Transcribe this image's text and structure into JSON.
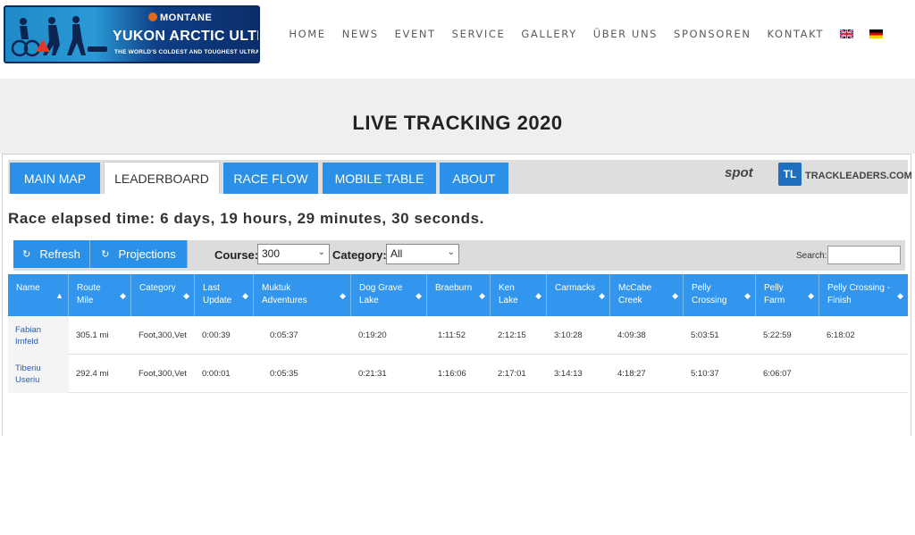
{
  "header": {
    "logo": {
      "brand": "MONTANE",
      "title": "YUKON ARCTIC ULTRA",
      "tagline": "THE WORLD'S COLDEST AND TOUGHEST ULTRA"
    },
    "nav": [
      "HOME",
      "NEWS",
      "EVENT",
      "SERVICE",
      "GALLERY",
      "ÜBER UNS",
      "SPONSOREN",
      "KONTAKT"
    ],
    "flags": [
      "uk-flag-icon",
      "de-flag-icon"
    ]
  },
  "page": {
    "title": "LIVE TRACKING 2020"
  },
  "tabs": [
    "MAIN MAP",
    "LEADERBOARD",
    "RACE FLOW",
    "MOBILE TABLE",
    "ABOUT"
  ],
  "active_tab": "LEADERBOARD",
  "sponsors": {
    "spot": "spot",
    "trackleaders_badge": "TL",
    "trackleaders": "TRACKLEADERS.COM"
  },
  "elapsed": "Race elapsed time: 6 days, 19 hours, 29 minutes, 30 seconds.",
  "controls": {
    "refresh": "Refresh",
    "projections": "Projections",
    "course_label": "Course:",
    "course_value": "300",
    "category_label": "Category:",
    "category_value": "All",
    "search_label": "Search:"
  },
  "table": {
    "columns": [
      {
        "l1": "Name",
        "l2": ""
      },
      {
        "l1": "Route",
        "l2": "Mile"
      },
      {
        "l1": "Category",
        "l2": ""
      },
      {
        "l1": "Last",
        "l2": "Update"
      },
      {
        "l1": "Muktuk",
        "l2": "Adventures"
      },
      {
        "l1": "Dog Grave",
        "l2": "Lake"
      },
      {
        "l1": "Braeburn",
        "l2": ""
      },
      {
        "l1": "Ken",
        "l2": "Lake"
      },
      {
        "l1": "Carmacks",
        "l2": ""
      },
      {
        "l1": "McCabe",
        "l2": "Creek"
      },
      {
        "l1": "Pelly",
        "l2": "Crossing"
      },
      {
        "l1": "Pelly",
        "l2": "Farm"
      },
      {
        "l1": "Pelly Crossing -",
        "l2": "Finish"
      }
    ],
    "rows": [
      {
        "first": "Fabian",
        "last": "Imfeld",
        "cells": [
          "305.1 mi",
          "Foot,300,Vet",
          "0:00:39",
          "0:05:37",
          "0:19:20",
          "1:11:52",
          "2:12:15",
          "3:10:28",
          "4:09:38",
          "5:03:51",
          "5:22:59",
          "6:18:02"
        ]
      },
      {
        "first": "Tiberiu",
        "last": "Useriu",
        "cells": [
          "292.4 mi",
          "Foot,300,Vet",
          "0:00:01",
          "0:05:35",
          "0:21:31",
          "1:16:06",
          "2:17:01",
          "3:14:13",
          "4:18:27",
          "5:10:37",
          "6:06:07",
          ""
        ]
      }
    ]
  }
}
